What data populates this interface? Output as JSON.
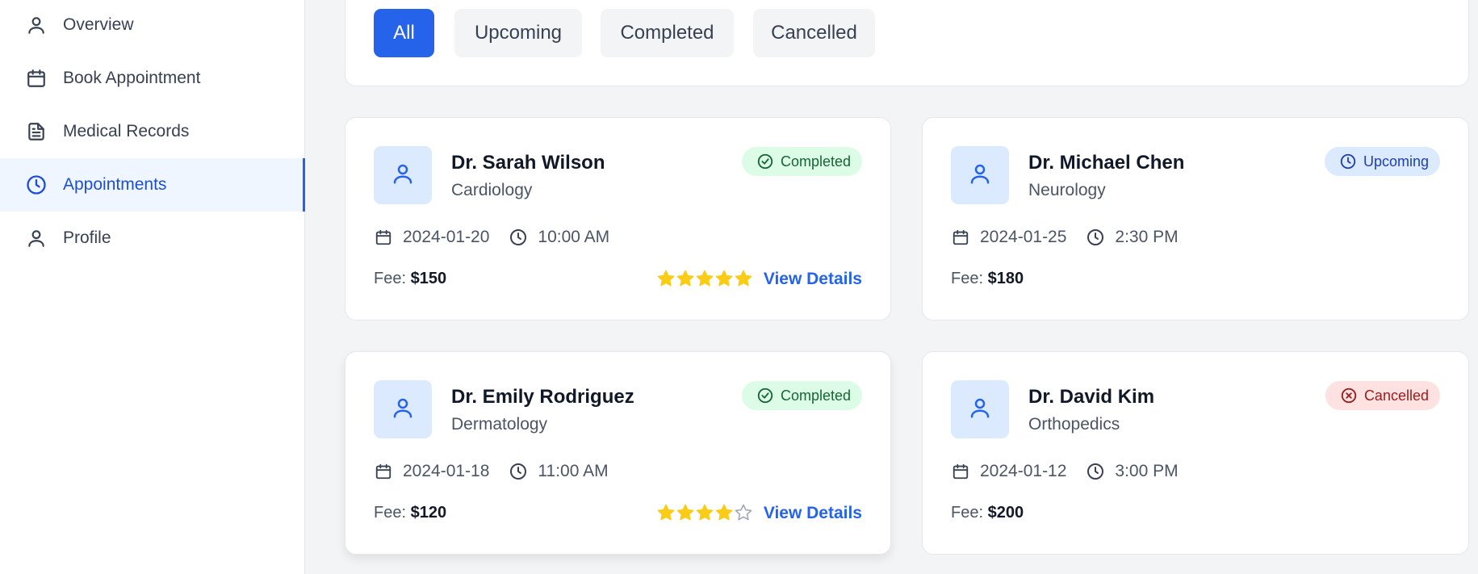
{
  "sidebar": {
    "items": [
      {
        "label": "Overview",
        "icon": "user-icon"
      },
      {
        "label": "Book Appointment",
        "icon": "calendar-icon"
      },
      {
        "label": "Medical Records",
        "icon": "document-icon"
      },
      {
        "label": "Appointments",
        "icon": "clock-icon",
        "active": true
      },
      {
        "label": "Profile",
        "icon": "user-icon"
      }
    ]
  },
  "filters": [
    "All",
    "Upcoming",
    "Completed",
    "Cancelled"
  ],
  "colors": {
    "accent": "#2563eb",
    "completed": "#166534",
    "upcoming": "#1e40af",
    "cancelled": "#991b1b",
    "star": "#facc15"
  },
  "appointments": [
    {
      "doctor": "Dr. Sarah Wilson",
      "specialty": "Cardiology",
      "status": "Completed",
      "date": "2024-01-20",
      "time": "10:00 AM",
      "fee_label": "Fee:",
      "fee": "$150",
      "rating": 5,
      "action": "View Details"
    },
    {
      "doctor": "Dr. Michael Chen",
      "specialty": "Neurology",
      "status": "Upcoming",
      "date": "2024-01-25",
      "time": "2:30 PM",
      "fee_label": "Fee:",
      "fee": "$180"
    },
    {
      "doctor": "Dr. Emily Rodriguez",
      "specialty": "Dermatology",
      "status": "Completed",
      "date": "2024-01-18",
      "time": "11:00 AM",
      "fee_label": "Fee:",
      "fee": "$120",
      "rating": 4,
      "action": "View Details"
    },
    {
      "doctor": "Dr. David Kim",
      "specialty": "Orthopedics",
      "status": "Cancelled",
      "date": "2024-01-12",
      "time": "3:00 PM",
      "fee_label": "Fee:",
      "fee": "$200"
    }
  ]
}
